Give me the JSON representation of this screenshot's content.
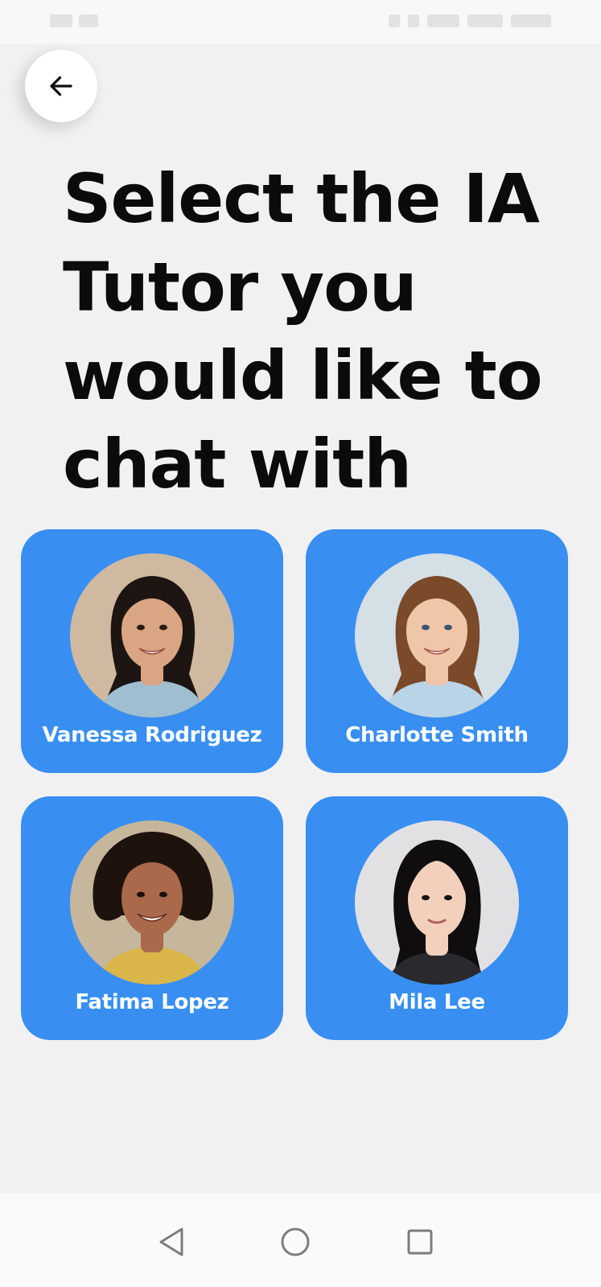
{
  "header": {
    "title": "Select the IA Tutor you would like to chat with"
  },
  "tutors": [
    {
      "name": "Vanessa Rodriguez",
      "bg": "#cfb9a0",
      "skin": "#d9a583",
      "hair": "#1d1512",
      "shirt": "#9fbfd0"
    },
    {
      "name": "Charlotte Smith",
      "bg": "#d4dfe6",
      "skin": "#f0c6a8",
      "hair": "#7a4a2a",
      "shirt": "#b9d4e6"
    },
    {
      "name": "Fatima Lopez",
      "bg": "#c5b69c",
      "skin": "#a9694a",
      "hair": "#1e120c",
      "shirt": "#d9b54a"
    },
    {
      "name": "Mila Lee",
      "bg": "#e1e1e3",
      "skin": "#f2d0bb",
      "hair": "#0f0d0e",
      "shirt": "#2a2a2e"
    }
  ],
  "colors": {
    "card": "#388ff1",
    "background": "#f1f1f2",
    "title": "#0b0b0b"
  },
  "icons": {
    "back": "arrow-left-icon",
    "nav_back": "triangle-back-icon",
    "nav_home": "circle-home-icon",
    "nav_recents": "square-recents-icon"
  }
}
